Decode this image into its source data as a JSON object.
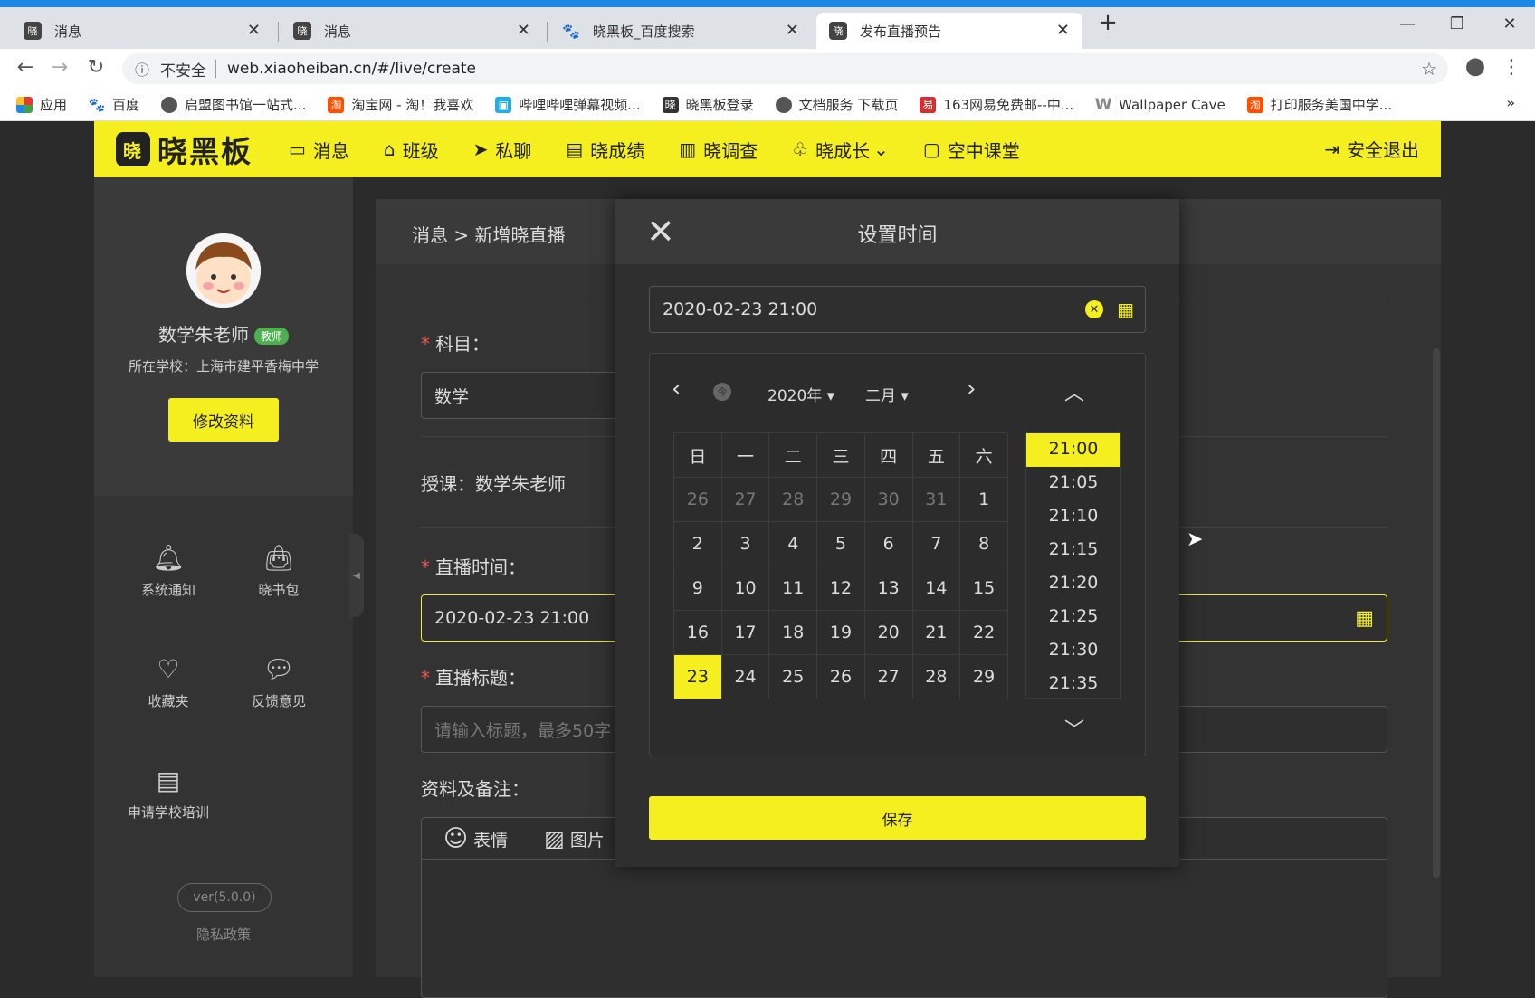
{
  "browser": {
    "tabs": [
      {
        "title": "消息"
      },
      {
        "title": "消息"
      },
      {
        "title": "晓黑板_百度搜索"
      },
      {
        "title": "发布直播预告"
      }
    ],
    "new_tab": "+",
    "address": {
      "security": "不安全",
      "url": "web.xiaoheiban.cn/#/live/create"
    },
    "bookmarks": [
      {
        "label": "应用"
      },
      {
        "label": "百度"
      },
      {
        "label": "启盟图书馆一站式..."
      },
      {
        "label": "淘宝网 - 淘！我喜欢"
      },
      {
        "label": "哔哩哔哩弹幕视频..."
      },
      {
        "label": "晓黑板登录"
      },
      {
        "label": "文档服务 下载页"
      },
      {
        "label": "163网易免费邮--中..."
      },
      {
        "label": "Wallpaper Cave"
      },
      {
        "label": "打印服务美国中学..."
      }
    ],
    "bookmarks_more": "»"
  },
  "app": {
    "logo_text": "晓黑板",
    "logo_mark": "晓",
    "nav": [
      {
        "label": "消息",
        "icon": "message-icon"
      },
      {
        "label": "班级",
        "icon": "home-icon"
      },
      {
        "label": "私聊",
        "icon": "send-icon"
      },
      {
        "label": "晓成绩",
        "icon": "report-icon"
      },
      {
        "label": "晓调查",
        "icon": "bar-chart-icon"
      },
      {
        "label": "晓成长",
        "icon": "sprout-icon"
      },
      {
        "label": "空中课堂",
        "icon": "book-icon"
      }
    ],
    "logout": "安全退出",
    "accent": "#f5ef1f"
  },
  "sidebar": {
    "name": "数学朱老师",
    "badge": "教师",
    "school": "所在学校：上海市建平香梅中学",
    "edit_button": "修改资料",
    "shortcuts": [
      {
        "label": "系统通知",
        "icon": "bell-icon"
      },
      {
        "label": "晓书包",
        "icon": "bag-icon"
      },
      {
        "label": "收藏夹",
        "icon": "heart-icon"
      },
      {
        "label": "反馈意见",
        "icon": "feedback-icon"
      },
      {
        "label": "申请学校培训",
        "icon": "document-icon"
      }
    ],
    "version": "ver(5.0.0)",
    "privacy": "隐私政策"
  },
  "form": {
    "breadcrumb": "消息 > 新增晓直播",
    "subject_label": "科目：",
    "subject_value": "数学",
    "teacher_line": "授课：数学朱老师",
    "time_label": "直播时间：",
    "time_value": "2020-02-23 21:00",
    "title_label": "直播标题：",
    "title_placeholder": "请输入标题，最多50字",
    "notes_label": "资料及备注：",
    "toolbar_emoji": "表情",
    "toolbar_image": "图片"
  },
  "modal": {
    "title": "设置时间",
    "input_value": "2020-02-23 21:00",
    "year": "2020年",
    "month": "二月",
    "today_mark": "今",
    "weekdays": [
      "日",
      "一",
      "二",
      "三",
      "四",
      "五",
      "六"
    ],
    "weeks": [
      [
        "26",
        "27",
        "28",
        "29",
        "30",
        "31",
        "1"
      ],
      [
        "2",
        "3",
        "4",
        "5",
        "6",
        "7",
        "8"
      ],
      [
        "9",
        "10",
        "11",
        "12",
        "13",
        "14",
        "15"
      ],
      [
        "16",
        "17",
        "18",
        "19",
        "20",
        "21",
        "22"
      ],
      [
        "23",
        "24",
        "25",
        "26",
        "27",
        "28",
        "29"
      ]
    ],
    "selected_day": "23",
    "times": [
      "21:00",
      "21:05",
      "21:10",
      "21:15",
      "21:20",
      "21:25",
      "21:30",
      "21:35"
    ],
    "selected_time": "21:00",
    "save": "保存"
  }
}
